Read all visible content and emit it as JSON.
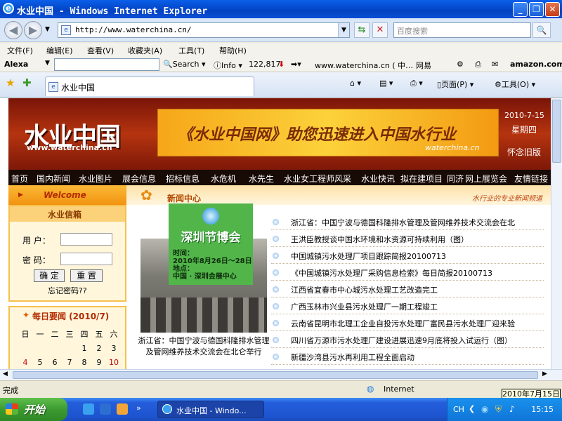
{
  "window": {
    "title": "水业中国 - Windows Internet Explorer"
  },
  "address": {
    "url": "http://www.waterchina.cn/",
    "search_placeholder": "百度搜索"
  },
  "menu": [
    "文件(F)",
    "编辑(E)",
    "查看(V)",
    "收藏夹(A)",
    "工具(T)",
    "帮助(H)"
  ],
  "alexa": {
    "label": "Alexa",
    "search": "Search",
    "info": "Info",
    "rank": "122,817",
    "site": "www.waterchina.cn ( 中…",
    "wangyi": "网易",
    "amazon": "amazon.com"
  },
  "tab": {
    "title": "水业中国"
  },
  "toolbar_right": {
    "page": "页面(P)",
    "tools": "工具(O)"
  },
  "site": {
    "logo": "水业中国",
    "logo_url": "www.waterchina.cn",
    "ad_text": "《水业中国网》助您迅速进入中国水行业",
    "ad_url": "waterchina.cn",
    "date": "2010-7-15",
    "weekday": "星期四",
    "old_version": "怀念旧版",
    "nav": [
      "首页",
      "国内新闻",
      "水业图片",
      "展会信息",
      "招标信息",
      "水危机",
      "水先生",
      "水业女工程师风采",
      "水业快讯",
      "拟在建项目",
      "同济",
      "网上展览会",
      "友情链接"
    ],
    "welcome": "Welcome",
    "news_center": "新闻中心",
    "slogan": "水行业的专业新闻频道",
    "mailbox": {
      "title": "水业信箱",
      "user_label": "用 户：",
      "pass_label": "密 码：",
      "ok": "确 定",
      "reset": "重 置",
      "forgot": "忘记密码??"
    },
    "calendar": {
      "title": "每日要闻 (2010/7)",
      "weekdays": [
        "日",
        "一",
        "二",
        "三",
        "四",
        "五",
        "六"
      ],
      "row1": [
        "",
        "",
        "",
        "",
        "1",
        "2",
        "3"
      ],
      "row2": [
        "4",
        "5",
        "6",
        "7",
        "8",
        "9",
        "10"
      ]
    },
    "promo": {
      "title": "深圳节博会",
      "time_label": "时间：",
      "time": "2010年8月26日～28日",
      "place_label": "地点：",
      "place": "中国 · 深圳会展中心"
    },
    "caption": "浙江省：中国宁波与德国科隆排水管理及管网维养技术交流会在北仑举行",
    "news": [
      "浙江省：中国宁波与德国科隆排水管理及管网维养技术交流会在北",
      "王洪臣教授谈中国水环境和水资源可持续利用（图）",
      "中国城镇污水处理厂项目跟踪简报20100713",
      "《中国城镇污水处理厂采购信息检索》每日简报20100713",
      "江西省宜春市中心城污水处理工艺改造完工",
      "广西玉林市兴业县污水处理厂一期工程竣工",
      "云南省昆明市北理工企业自投污水处理厂富民县污水处理厂迎来验",
      "四川省万源市污水处理厂建设进展迅速9月底将投入试运行（图）",
      "新疆沙湾县污水再利用工程全面启动"
    ]
  },
  "status": {
    "text": "完成",
    "zone": "Internet",
    "tooltip": "2010年7月15日"
  },
  "taskbar": {
    "start": "开始",
    "item": "水业中国 - Windo...",
    "ime": "CH",
    "time": "15:15"
  }
}
